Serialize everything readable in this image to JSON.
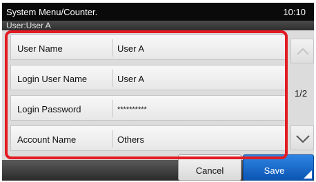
{
  "header": {
    "title": "System Menu/Counter.",
    "clock": "10:10"
  },
  "user_bar": {
    "text": "User:User A"
  },
  "rows": [
    {
      "label": "User Name",
      "value": "User A"
    },
    {
      "label": "Login User Name",
      "value": "User A"
    },
    {
      "label": "Login Password",
      "value": "**********"
    },
    {
      "label": "Account Name",
      "value": "Others"
    }
  ],
  "pager": {
    "indicator": "1/2",
    "up_icon": "chevron-up-icon",
    "down_icon": "chevron-down-icon"
  },
  "buttons": {
    "cancel": "Cancel",
    "save": "Save"
  },
  "colors": {
    "highlight": "#e31b23",
    "save_button": "#1f6fd0",
    "title_bar": "#0a0a0a"
  }
}
